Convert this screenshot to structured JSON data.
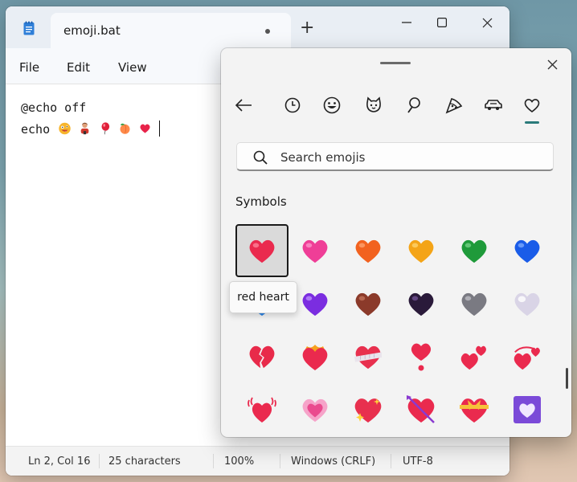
{
  "notepad": {
    "tab_title": "emoji.bat",
    "menu": [
      "File",
      "Edit",
      "View"
    ],
    "code": {
      "line1": "@echo off",
      "line2_prefix": "echo "
    },
    "status": {
      "position": "Ln 2, Col 16",
      "characters": "25 characters",
      "zoom": "100%",
      "line_ending": "Windows (CRLF)",
      "encoding": "UTF-8"
    }
  },
  "picker": {
    "search_placeholder": "Search emojis",
    "section_title": "Symbols",
    "tooltip": "red heart",
    "categories": [
      "back",
      "recent",
      "smiley",
      "animals",
      "food",
      "travel",
      "vehicles",
      "symbols"
    ],
    "selected_category": "symbols",
    "emoji_names": [
      "red heart",
      "pink heart",
      "orange heart",
      "yellow heart",
      "green heart",
      "blue heart",
      "light blue heart",
      "purple heart",
      "brown heart",
      "black heart",
      "grey heart",
      "white heart",
      "broken heart",
      "heart on fire",
      "mending heart",
      "heart exclamation",
      "two hearts",
      "revolving hearts",
      "beating heart",
      "growing heart",
      "sparkling heart",
      "heart with arrow",
      "heart with ribbon",
      "heart decoration"
    ]
  },
  "colors": {
    "accent": "#2a7a7a",
    "red_heart": "#e8234a"
  }
}
